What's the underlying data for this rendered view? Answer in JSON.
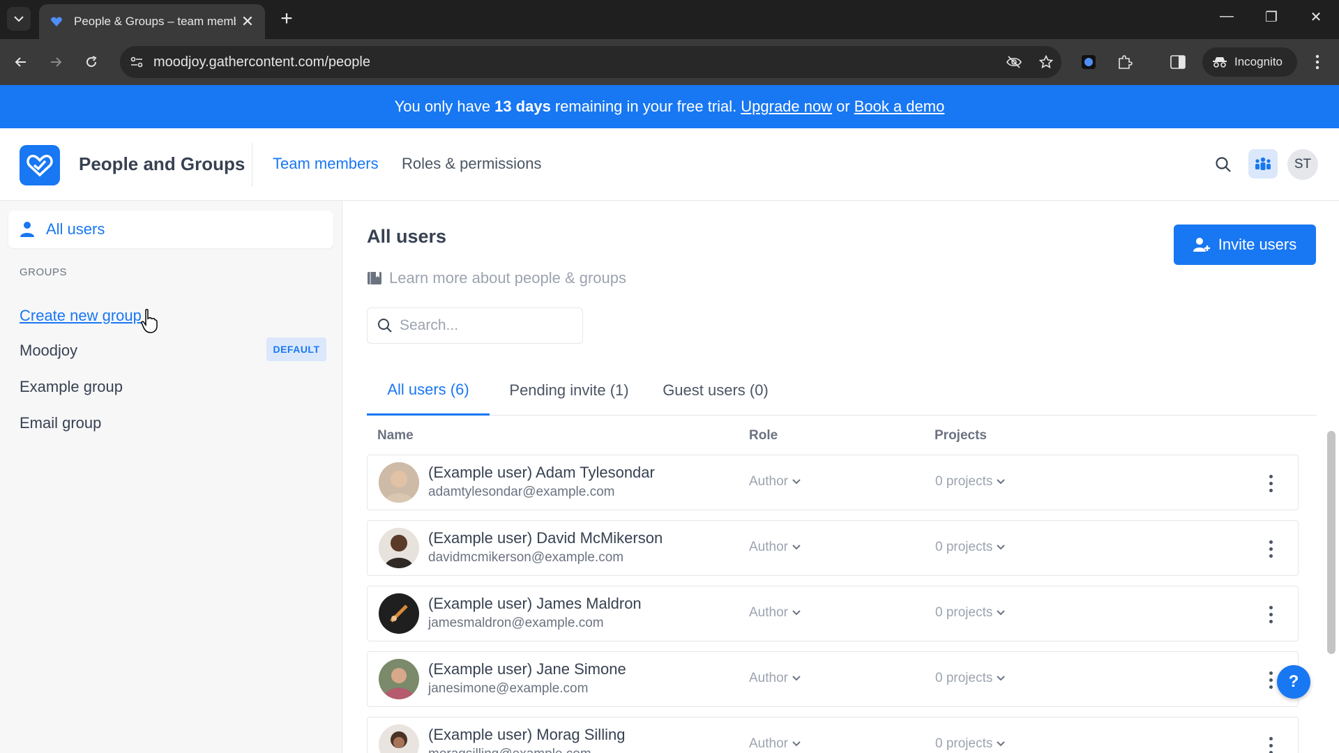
{
  "browser": {
    "tab_title": "People & Groups – team memb",
    "url": "moodjoy.gathercontent.com/people",
    "incognito_label": "Incognito"
  },
  "banner": {
    "prefix": "You only have",
    "days": "13 days",
    "middle": "remaining in your free trial.",
    "upgrade_link": "Upgrade now",
    "or": "or",
    "demo_link": "Book a demo"
  },
  "header": {
    "app_title": "People and Groups",
    "nav": [
      {
        "label": "Team members",
        "active": true
      },
      {
        "label": "Roles & permissions",
        "active": false
      }
    ],
    "avatar_initials": "ST"
  },
  "sidebar": {
    "all_users_label": "All users",
    "groups_heading": "GROUPS",
    "create_group_link": "Create new group",
    "groups": [
      {
        "name": "Moodjoy",
        "badge": "DEFAULT"
      },
      {
        "name": "Example group"
      },
      {
        "name": "Email group"
      }
    ]
  },
  "main": {
    "title": "All users",
    "invite_button": "Invite users",
    "learn_more": "Learn more about people & groups",
    "search_placeholder": "Search...",
    "tabs": [
      {
        "label": "All users (6)",
        "active": true
      },
      {
        "label": "Pending invite (1)",
        "active": false
      },
      {
        "label": "Guest users (0)",
        "active": false
      }
    ],
    "columns": {
      "name": "Name",
      "role": "Role",
      "projects": "Projects"
    },
    "users": [
      {
        "name": "(Example user) Adam Tylesondar",
        "email": "adamtylesondar@example.com",
        "role": "Author",
        "projects": "0 projects",
        "avatar_color": "#c9a98f"
      },
      {
        "name": "(Example user) David McMikerson",
        "email": "davidmcmikerson@example.com",
        "role": "Author",
        "projects": "0 projects",
        "avatar_color": "#5a3a28"
      },
      {
        "name": "(Example user) James Maldron",
        "email": "jamesmaldron@example.com",
        "role": "Author",
        "projects": "0 projects",
        "avatar_color": "#1f1f1f"
      },
      {
        "name": "(Example user) Jane Simone",
        "email": "janesimone@example.com",
        "role": "Author",
        "projects": "0 projects",
        "avatar_color": "#b65a6e"
      },
      {
        "name": "(Example user) Morag Silling",
        "email": "moragsilling@example.com",
        "role": "Author",
        "projects": "0 projects",
        "avatar_color": "#4a3226"
      }
    ]
  },
  "help_button": "?"
}
